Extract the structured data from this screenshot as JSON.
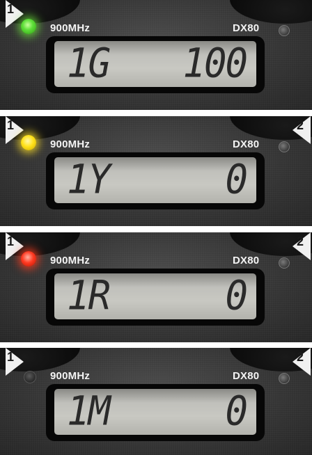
{
  "panels": [
    {
      "left_tab": "1",
      "right_tab": "",
      "led_color": "#56d52a",
      "led_state": "green",
      "frequency": "900MHz",
      "model": "DX80",
      "display_channel": "1G",
      "display_value": "100"
    },
    {
      "left_tab": "1",
      "right_tab": "2",
      "led_color": "#f5e01c",
      "led_state": "yellow",
      "frequency": "900MHz",
      "model": "DX80",
      "display_channel": "1Y",
      "display_value": "0"
    },
    {
      "left_tab": "1",
      "right_tab": "2",
      "led_color": "#f2301c",
      "led_state": "red",
      "frequency": "900MHz",
      "model": "DX80",
      "display_channel": "1R",
      "display_value": "0"
    },
    {
      "left_tab": "1",
      "right_tab": "2",
      "led_color": "#3a3a3a",
      "led_state": "off",
      "frequency": "900MHz",
      "model": "DX80",
      "display_channel": "1M",
      "display_value": "0"
    }
  ]
}
